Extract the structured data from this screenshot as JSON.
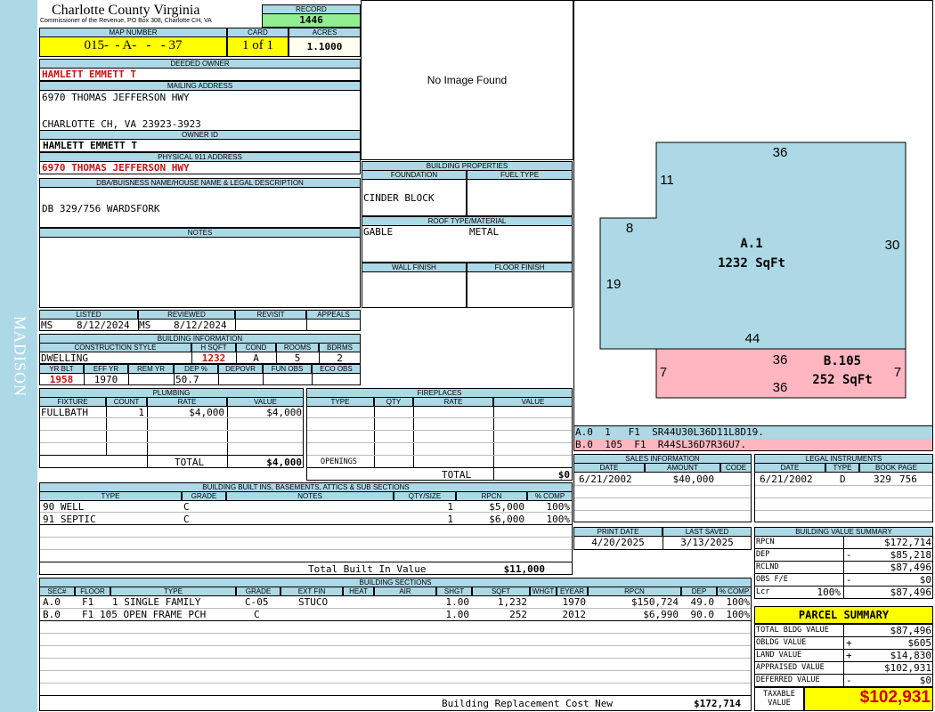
{
  "sidebar": {
    "magisterial_district": "MADISON"
  },
  "header": {
    "county": "Charlotte County Virginia",
    "office": "Commissioner of the Revenue, PO Box 308, Charlotte CH, VA",
    "record_label": "RECORD",
    "record": "1446",
    "map_number_label": "MAP NUMBER",
    "map_number": "015-  - A-   -   - 37",
    "card_label": "CARD",
    "card": "1 of 1",
    "acres_label": "ACRES",
    "acres": "1.1000"
  },
  "owner": {
    "deeded_owner_label": "DEEDED OWNER",
    "deeded_owner": "HAMLETT EMMETT T",
    "mailing_label": "MAILING ADDRESS",
    "mailing_line1": "6970 THOMAS JEFFERSON HWY",
    "mailing_line2": "CHARLOTTE CH, VA 23923-3923",
    "owner_id_label": "OWNER ID",
    "owner_id": "HAMLETT EMMETT T",
    "physical_label": "PHYSICAL 911 ADDRESS",
    "physical": "6970 THOMAS JEFFERSON HWY",
    "legal_label": "DBA/BUISNESS NAME/HOUSE NAME & LEGAL DESCRIPTION",
    "legal": "DB 329/756 WARDSFORK",
    "notes_label": "NOTES"
  },
  "photo": {
    "no_image": "No Image Found"
  },
  "building_properties": {
    "title": "BUILDING PROPERTIES",
    "foundation_label": "FOUNDATION",
    "foundation": "CINDER BLOCK",
    "fuel_label": "FUEL TYPE",
    "fuel": "",
    "roof_label": "ROOF TYPE/MATERIAL",
    "roof_type": "GABLE",
    "roof_material": "METAL",
    "wall_label": "WALL FINISH",
    "floor_label": "FLOOR FINISH"
  },
  "sketch": {
    "a_label": "A.1",
    "a_area": "1232 SqFt",
    "b_label": "B.105",
    "b_area": "252 SqFt",
    "dims": {
      "a_top": "36",
      "a_step_v": "11",
      "a_step_h": "8",
      "a_right": "30",
      "a_left": "19",
      "a_bottom": "44",
      "b_top": "36",
      "b_bottom": "36",
      "b_left": "7",
      "b_right": "7"
    },
    "colors": {
      "a_fill": "#add8e6",
      "b_fill": "#ffb6c1"
    }
  },
  "vectors": [
    {
      "text": "A.0  1   F1  SR44U30L36D11L8D19."
    },
    {
      "text": "B.0  105  F1  R44SL36D7R36U7."
    }
  ],
  "review": {
    "listed_label": "LISTED",
    "listed_by": "MS",
    "listed_date": "8/12/2024",
    "reviewed_label": "REVIEWED",
    "reviewed_by": "MS",
    "reviewed_date": "8/12/2024",
    "revisit_label": "REVISIT",
    "appeals_label": "APPEALS"
  },
  "building_info": {
    "title": "BUILDING INFORMATION",
    "construction_label": "CONSTRUCTION STYLE",
    "construction": "DWELLING",
    "hsqft_label": "H SQFT",
    "hsqft": "1232",
    "cond_label": "COND",
    "cond": "A",
    "rooms_label": "ROOMS",
    "rooms": "5",
    "bdrms_label": "BDRMS",
    "bdrms": "2",
    "yr_blt_label": "YR BLT",
    "yr_blt": "1958",
    "eff_yr_label": "EFF YR",
    "eff_yr": "1970",
    "rem_yr_label": "REM YR",
    "rem_yr": "",
    "dep_label": "DEP %",
    "dep": "50.7",
    "depovr_label": "DEPOVR",
    "funobs_label": "FUN OBS",
    "ecoobs_label": "ECO OBS"
  },
  "plumbing": {
    "title": "PLUMBING",
    "headers": [
      "FIXTURE",
      "COUNT",
      "RATE",
      "VALUE"
    ],
    "rows": [
      {
        "fixture": "FULLBATH",
        "count": "1",
        "rate": "$4,000",
        "value": "$4,000"
      }
    ],
    "total_label": "TOTAL",
    "total": "$4,000"
  },
  "fireplaces": {
    "title": "FIREPLACES",
    "headers": [
      "TYPE",
      "QTY",
      "RATE",
      "VALUE"
    ],
    "openings_label": "OPENINGS",
    "total_label": "TOTAL",
    "total": "$0"
  },
  "built_ins": {
    "title": "BUILDING BUILT INS, BASEMENTS, ATTICS & SUB SECTIONS",
    "headers": [
      "TYPE",
      "GRADE",
      "NOTES",
      "QTY/SIZE",
      "RPCN",
      "% COMP"
    ],
    "rows": [
      {
        "type": "90 WELL",
        "grade": "C",
        "notes": "",
        "qty": "1",
        "rpcn": "$5,000",
        "comp": "100%"
      },
      {
        "type": "91 SEPTIC",
        "grade": "C",
        "notes": "",
        "qty": "1",
        "rpcn": "$6,000",
        "comp": "100%"
      }
    ],
    "total_label": "Total Built In Value",
    "total": "$11,000"
  },
  "sections": {
    "title": "BUILDING SECTIONS",
    "headers": [
      "SEC#",
      "FLOOR",
      "TYPE",
      "GRADE",
      "EXT FIN",
      "HEAT",
      "AIR",
      "SHGT",
      "SQFT",
      "WHGT",
      "EYEAR",
      "RPCN",
      "DEP",
      "% COMP"
    ],
    "rows": [
      {
        "sec": "A.0",
        "floor": "F1",
        "type": "1 SINGLE FAMILY",
        "grade": "C-05",
        "ext": "STUCO",
        "heat": "",
        "air": "",
        "shgt": "1.00",
        "sqft": "1,232",
        "whgt": "",
        "eyear": "1970",
        "rpcn": "$150,724",
        "dep": "49.0",
        "comp": "100%"
      },
      {
        "sec": "B.0",
        "floor": "F1",
        "type": "105 OPEN FRAME PCH",
        "grade": "C",
        "ext": "",
        "heat": "",
        "air": "",
        "shgt": "1.00",
        "sqft": "252",
        "whgt": "",
        "eyear": "2012",
        "rpcn": "$6,990",
        "dep": "90.0",
        "comp": "100%"
      }
    ],
    "rcn_label": "Building Replacement Cost New",
    "rcn": "$172,714"
  },
  "sales": {
    "title": "SALES INFORMATION",
    "headers": [
      "DATE",
      "AMOUNT",
      "CODE"
    ],
    "rows": [
      {
        "date": "6/21/2002",
        "amount": "$40,000",
        "code": ""
      }
    ]
  },
  "legal_instruments": {
    "title": "LEGAL INSTRUMENTS",
    "headers": [
      "DATE",
      "TYPE",
      "BOOK PAGE"
    ],
    "rows": [
      {
        "date": "6/21/2002",
        "type": "D",
        "book": "329",
        "page": "756"
      }
    ]
  },
  "dates": {
    "print_label": "PRINT DATE",
    "print": "4/20/2025",
    "saved_label": "LAST SAVED",
    "saved": "3/13/2025"
  },
  "value_summary": {
    "title": "BUILDING VALUE SUMMARY",
    "rpcn_label": "RPCN",
    "rpcn": "$172,714",
    "dep_label": "DEP",
    "dep_sign": "-",
    "dep": "$85,218",
    "rclnd_label": "RCLND",
    "rclnd": "$87,496",
    "obs_label": "OBS F/E",
    "obs_sign": "-",
    "obs": "$0",
    "lcr_label": "Lcr",
    "lcr_pct": "100%",
    "lcr": "$87,496"
  },
  "parcel_summary": {
    "title": "PARCEL SUMMARY",
    "bldg_label": "TOTAL BLDG VALUE",
    "bldg": "$87,496",
    "obldg_label": "OBLDG VALUE",
    "obldg_sign": "+",
    "obldg": "$605",
    "land_label": "LAND VALUE",
    "land_sign": "+",
    "land": "$14,830",
    "appraised_label": "APPRAISED VALUE",
    "appraised": "$102,931",
    "deferred_label": "DEFERRED VALUE",
    "deferred_sign": "-",
    "deferred": "$0",
    "taxable_label1": "TAXABLE",
    "taxable_label2": "VALUE",
    "taxable": "$102,931",
    "colors": {
      "yellow": "#ffff00",
      "red": "#cc0000"
    }
  }
}
